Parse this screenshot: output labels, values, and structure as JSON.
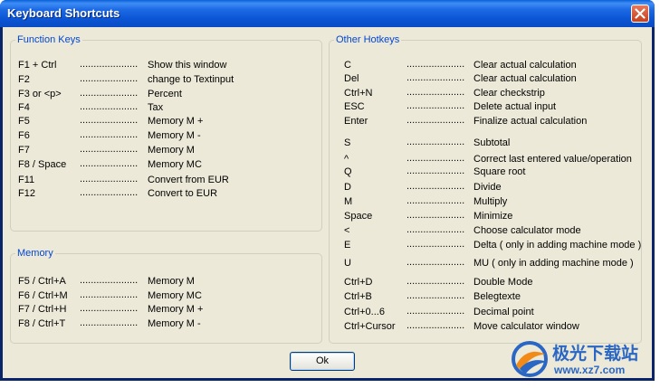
{
  "window": {
    "title": "Keyboard Shortcuts"
  },
  "groups": {
    "function_keys": {
      "label": "Function Keys",
      "rows": [
        {
          "key": "F1 + Ctrl",
          "dots": ".....................",
          "desc": "Show this window"
        },
        {
          "key": "F2",
          "dots": ".....................",
          "desc": "change to Textinput"
        },
        {
          "key": "F3 or <p>",
          "dots": ".....................",
          "desc": "Percent"
        },
        {
          "key": "F4",
          "dots": ".....................",
          "desc": "Tax"
        },
        {
          "key": "F5",
          "dots": ".....................",
          "desc": "Memory M +"
        },
        {
          "key": "F6",
          "dots": ".....................",
          "desc": "Memory M -"
        },
        {
          "key": "F7",
          "dots": ".....................",
          "desc": "Memory M"
        },
        {
          "key": "F8 / Space",
          "dots": ".....................",
          "desc": "Memory MC"
        },
        {
          "key": "F11",
          "dots": ".....................",
          "desc": "Convert from EUR"
        },
        {
          "key": "F12",
          "dots": ".....................",
          "desc": "Convert to EUR"
        }
      ]
    },
    "memory": {
      "label": "Memory",
      "rows": [
        {
          "key": "F5 / Ctrl+A",
          "dots": ".....................",
          "desc": "Memory M"
        },
        {
          "key": "F6 / Ctrl+M",
          "dots": ".....................",
          "desc": "Memory MC"
        },
        {
          "key": "F7 / Ctrl+H",
          "dots": ".....................",
          "desc": "Memory M +"
        },
        {
          "key": "F8 / Ctrl+T",
          "dots": ".....................",
          "desc": "Memory M -"
        }
      ]
    },
    "other_hotkeys": {
      "label": "Other Hotkeys",
      "rows": [
        {
          "key": "C",
          "dots": ".....................",
          "desc": "Clear actual calculation"
        },
        {
          "key": "Del",
          "dots": ".....................",
          "desc": "Clear actual calculation"
        },
        {
          "key": "Ctrl+N",
          "dots": ".....................",
          "desc": "Clear checkstrip"
        },
        {
          "key": "ESC",
          "dots": ".....................",
          "desc": "Delete actual input"
        },
        {
          "key": "Enter",
          "dots": ".....................",
          "desc": "Finalize actual calculation"
        },
        {
          "key": "S",
          "dots": ".....................",
          "desc": "Subtotal"
        },
        {
          "key": "^",
          "dots": ".....................",
          "desc": "Correct last entered value/operation"
        },
        {
          "key": "Q",
          "dots": ".....................",
          "desc": "Square root"
        },
        {
          "key": "D",
          "dots": ".....................",
          "desc": "Divide"
        },
        {
          "key": "M",
          "dots": ".....................",
          "desc": "Multiply"
        },
        {
          "key": "Space",
          "dots": ".....................",
          "desc": "Minimize"
        },
        {
          "key": "<",
          "dots": ".....................",
          "desc": "Choose calculator mode"
        },
        {
          "key": "E",
          "dots": ".....................",
          "desc": "Delta ( only in adding machine mode )"
        },
        {
          "key": "U",
          "dots": ".....................",
          "desc": "MU ( only in adding machine mode )"
        },
        {
          "key": "Ctrl+D",
          "dots": ".....................",
          "desc": "Double Mode"
        },
        {
          "key": "Ctrl+B",
          "dots": ".....................",
          "desc": "Belegtexte"
        },
        {
          "key": "Ctrl+0...6",
          "dots": ".....................",
          "desc": "Decimal point"
        },
        {
          "key": "Ctrl+Cursor",
          "dots": ".....................",
          "desc": "Move calculator window"
        }
      ]
    }
  },
  "buttons": {
    "ok": "Ok"
  },
  "watermark": {
    "line1": "极光下载站",
    "line2": "www.xz7.com"
  },
  "colors": {
    "title_bar": "#0a5fd8",
    "legend_text": "#0046d5",
    "dialog_bg": "#ece9d8",
    "close_button": "#c3421f"
  },
  "icons": {
    "close": "close-icon",
    "watermark_logo": "aurora-logo-icon"
  }
}
